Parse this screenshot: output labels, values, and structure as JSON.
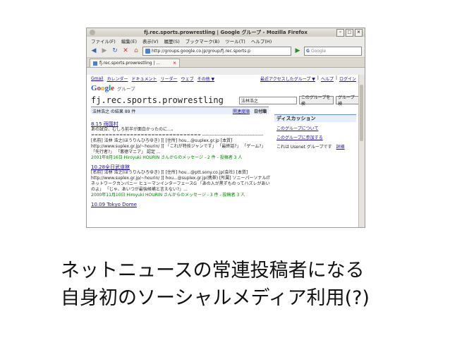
{
  "browser": {
    "title": "fj.rec.sports.prowrestling | Google グループ - Mozilla Firefox",
    "menu": [
      "ファイル(F)",
      "編集(E)",
      "表示(V)",
      "履歴(S)",
      "ブックマーク(B)",
      "ツール(T)",
      "ヘルプ(H)"
    ],
    "url": "http://groups.google.co.jp/group/fj.rec.sports.p",
    "search_placeholder": "Google",
    "tab_label": "fj.rec.sports.prowrestling | ..."
  },
  "google": {
    "toplinks": [
      "Gmail",
      "カレンダー",
      "ドキュメント",
      "リーダー",
      "ウェブ",
      "その他 ▼"
    ],
    "toplinks_right": [
      "最近アクセスしたグループ ▼",
      "ヘルプ",
      "ログイン"
    ],
    "logo_sub": "グループ",
    "group_name": "fj.rec.sports.prowrestling",
    "search_value": "法林浩之",
    "btn_search_group": "このグループを検",
    "btn_search_all": "グループ検"
  },
  "results_head": {
    "summary": "法林浩之 の結果 89 件",
    "relevance": "関連度順",
    "date": "日付順"
  },
  "sidebar": {
    "heading": "ディスカッション",
    "about": "このグループについて",
    "join": "このグループに参加する",
    "usenet_text": "これは Usenet グループです",
    "usenet_link": "詳細"
  },
  "results": [
    {
      "title": "8.15 両国村",
      "snippet": "あの試合、むしろ前半が面白かったのに…。 =============================== ---------------------------------------- [名前] 法林 浩之(ほうりんひろゆき) ][ [住所] hou...@suplex.gr.jp [本質] http://www.suplex.gr.jp/~hourin/ ][ 「これが特技ジャンです」 「最終話?」 「ゲーム?」 「先行者?」 「悪徳マニア」 認定 ...",
      "meta": "2001年8月16日 Hiroyuki HOURIN さんからのメッセージ - 2 件 - 投稿者 3 人"
    },
    {
      "title": "10.28全日武道館",
      "snippet": "[名前] 法林 浩之(ほうりんひろゆき) ][ [住所] hou...@ptt.sony.co.jp(会社) [本質] http://www.suplex.gr.jp/~hourin/ ][ hou...@suplex.gr.jp(携帯) [所属] ソニーパーソナルITネットワークカンパニー ヒューマンインターフェースG 「あの入が黒ずものってハズレがあいのよ」 「じゃ、あいつが最強候補と言えない?」...",
      "meta": "2000年11月10日 Hiroyuki HOURIN さんからのメッセージ - 3 件 - 投稿者 3 人"
    },
    {
      "title": "10.09 Tokyo Dome",
      "snippet": "",
      "meta": ""
    }
  ],
  "caption": {
    "line1": "ネットニュースの常連投稿者になる",
    "line2": "自身初のソーシャルメディア利用(?)"
  }
}
